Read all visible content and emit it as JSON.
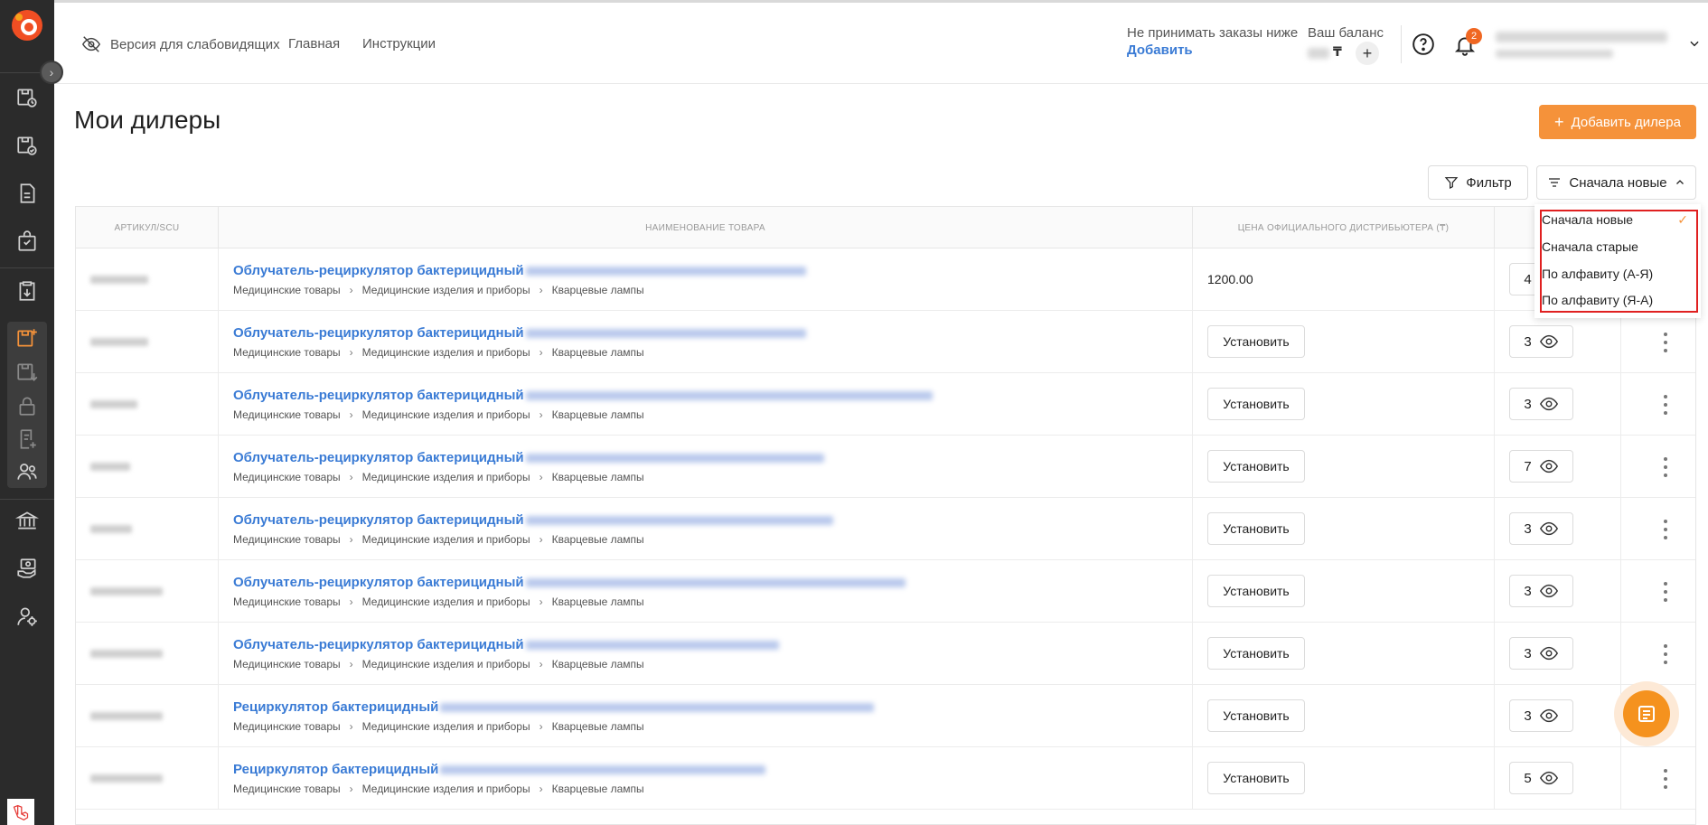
{
  "topbar": {
    "accessibility_label": "Версия для слабовидящих",
    "nav_main": "Главная",
    "nav_instructions": "Инструкции",
    "orders_note": "Не принимать заказы ниже",
    "orders_add": "Добавить",
    "balance_label": "Ваш баланс",
    "balance_currency": "₸",
    "notifications_count": "2"
  },
  "page": {
    "title": "Мои дилеры",
    "add_button": "Добавить дилера",
    "filter_button": "Фильтр",
    "sort_button": "Сначала новые"
  },
  "table": {
    "headers": {
      "sku": "АРТИКУЛ/SCU",
      "name": "НАИМЕНОВАНИЕ ТОВАРА",
      "price": "ЦЕНА ОФИЦИАЛЬНОГО ДИСТРИБЬЮТЕРА (₸)"
    },
    "crumbs": [
      "Медицинские товары",
      "Медицинские изделия и приборы",
      "Кварцевые лампы"
    ],
    "set_label": "Установить",
    "rows": [
      {
        "name": "Облучатель-рециркулятор бактерицидный",
        "price": "1200.00",
        "views": "4"
      },
      {
        "name": "Облучатель-рециркулятор бактерицидный",
        "price": "",
        "views": "3"
      },
      {
        "name": "Облучатель-рециркулятор бактерицидный",
        "price": "",
        "views": "3"
      },
      {
        "name": "Облучатель-рециркулятор бактерицидный",
        "price": "",
        "views": "7"
      },
      {
        "name": "Облучатель-рециркулятор бактерицидный",
        "price": "",
        "views": "3"
      },
      {
        "name": "Облучатель-рециркулятор бактерицидный",
        "price": "",
        "views": "3"
      },
      {
        "name": "Облучатель-рециркулятор бактерицидный",
        "price": "",
        "views": "3"
      },
      {
        "name": "Рециркулятор бактерицидный",
        "price": "",
        "views": "3"
      },
      {
        "name": "Рециркулятор бактерицидный",
        "price": "",
        "views": "5"
      }
    ]
  },
  "sort_dropdown": {
    "options": [
      "Сначала новые",
      "Сначала старые",
      "По алфавиту (А-Я)",
      "По алфавиту (Я-А)"
    ],
    "selected": "Сначала новые"
  },
  "colors": {
    "accent": "#f5923a",
    "link": "#3a7bd5",
    "sidebar": "#2b2b2b",
    "highlight_outline": "#e02020"
  }
}
